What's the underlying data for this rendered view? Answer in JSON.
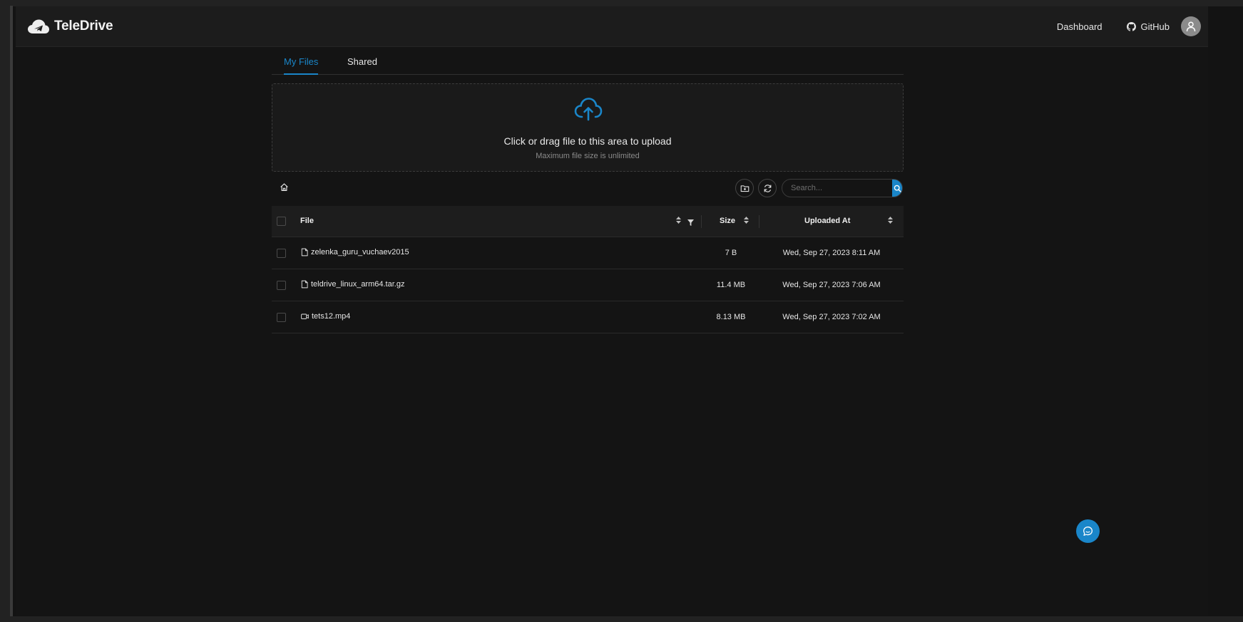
{
  "app": {
    "brand_name": "TeleDrive"
  },
  "navbar": {
    "dashboard_label": "Dashboard",
    "github_label": "GitHub",
    "avatar_icon": "user-icon"
  },
  "tabs": [
    {
      "label": "My Files",
      "active": true
    },
    {
      "label": "Shared",
      "active": false
    }
  ],
  "upload": {
    "icon": "cloud-upload-icon",
    "title": "Click or drag file to this area to upload",
    "hint": "Maximum file size is unlimited"
  },
  "toolbar": {
    "search_placeholder": "Search..."
  },
  "table": {
    "columns": {
      "file": "File",
      "size": "Size",
      "uploaded_at": "Uploaded At"
    },
    "rows": [
      {
        "type": "file",
        "name": "zelenka_guru_vuchaev2015",
        "size": "7 B",
        "uploaded_at": "Wed, Sep 27, 2023 8:11 AM"
      },
      {
        "type": "file",
        "name": "teldrive_linux_arm64.tar.gz",
        "size": "11.4 MB",
        "uploaded_at": "Wed, Sep 27, 2023 7:06 AM"
      },
      {
        "type": "video",
        "name": "tets12.mp4",
        "size": "8.13 MB",
        "uploaded_at": "Wed, Sep 27, 2023 7:02 AM"
      }
    ]
  },
  "colors": {
    "accent": "#1a86c9",
    "background": "#141414",
    "navbar": "#1c1c1c"
  }
}
